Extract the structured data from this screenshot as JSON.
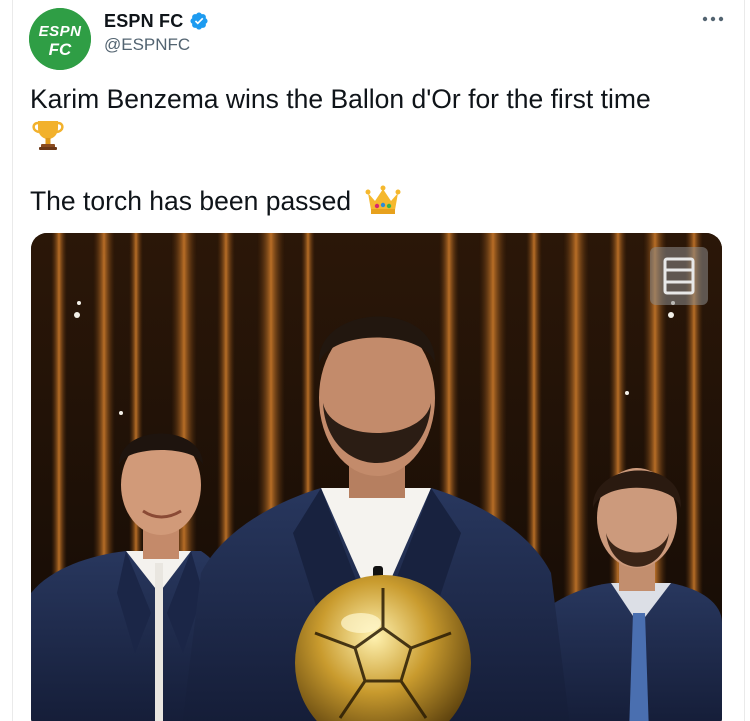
{
  "account": {
    "display_name": "ESPN FC",
    "handle": "@ESPNFC",
    "verified": true,
    "avatar_text_top": "ESPN",
    "avatar_text_bottom": "FC",
    "avatar_color": "#2f9e45"
  },
  "tweet": {
    "line1": "Karim Benzema wins the Ballon d'Or for the first time",
    "line1_emoji": "trophy-icon",
    "line2": "The torch has been passed",
    "line2_emoji": "crown-icon"
  },
  "colors": {
    "text": "#0f1419",
    "secondary": "#536471",
    "verified": "#1d9bf0"
  },
  "icons": {
    "more": "more-options-icon",
    "verified": "verified-badge-icon",
    "media_badge": "media-overlay-icon"
  }
}
